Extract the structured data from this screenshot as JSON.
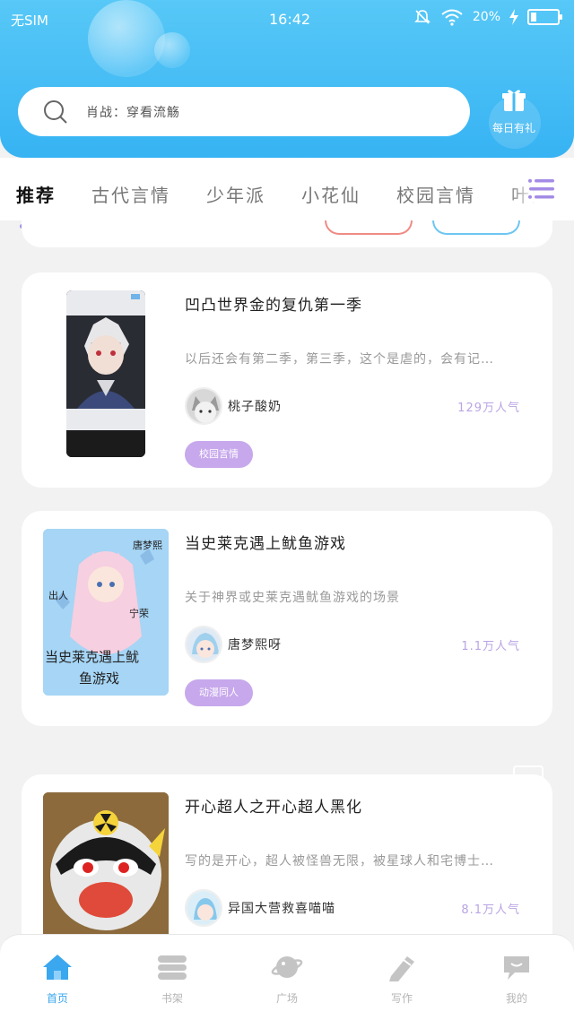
{
  "status_bar": {
    "carrier": "无SIM",
    "time": "16:42",
    "battery": "20%",
    "battery_level": 0.2
  },
  "search": {
    "placeholder": "肖战：穿看流觞"
  },
  "daily_gift": {
    "label": "每日有礼"
  },
  "tabs": [
    {
      "label": "推荐",
      "active": true
    },
    {
      "label": "古代言情"
    },
    {
      "label": "少年派"
    },
    {
      "label": "小花仙"
    },
    {
      "label": "校园言情"
    },
    {
      "label": "叶罗"
    }
  ],
  "books": [
    {
      "title": "凹凸世界金的复仇第一季",
      "desc": "以后还会有第二季，第三季，这个是虐的，会有记…",
      "author": "桃子酸奶",
      "popularity": "129万人气",
      "tag": "校园言情"
    },
    {
      "title": "当史莱克遇上鱿鱼游戏",
      "desc": "关于神界或史莱克遇鱿鱼游戏的场景",
      "author": "唐梦熙呀",
      "popularity": "1.1万人气",
      "tag": "动漫同人",
      "cover_text": [
        "唐梦熙",
        "出人",
        "宁荣",
        "当史莱克遇上鱿",
        "鱼游戏"
      ]
    },
    {
      "title": "开心超人之开心超人黑化",
      "desc": "写的是开心，超人被怪兽无限，被星球人和宅博士…",
      "author": "异国大营救喜喵喵",
      "popularity": "8.1万人气"
    }
  ],
  "bottom_nav": [
    {
      "label": "首页",
      "icon": "home-icon",
      "active": true
    },
    {
      "label": "书架",
      "icon": "bookshelf-icon"
    },
    {
      "label": "广场",
      "icon": "planet-icon"
    },
    {
      "label": "写作",
      "icon": "pen-icon"
    },
    {
      "label": "我的",
      "icon": "chat-bubble-icon"
    }
  ],
  "colors": {
    "header": "#4fc1f6",
    "accent": "#a38be6",
    "tag": "#c7a8ec",
    "nav_active": "#3aa7ee"
  }
}
